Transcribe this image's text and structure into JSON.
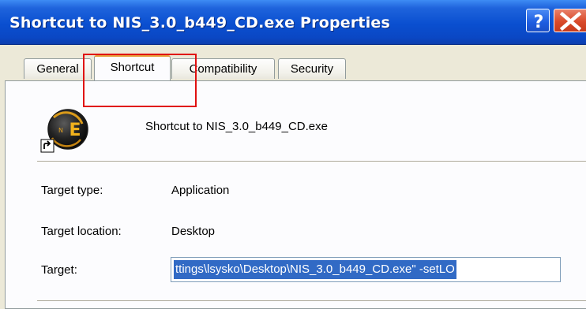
{
  "window": {
    "title": "Shortcut to NIS_3.0_b449_CD.exe Properties",
    "help_label": "?",
    "close_label": "X"
  },
  "tabs": [
    {
      "label": "General",
      "active": false
    },
    {
      "label": "Shortcut",
      "active": true
    },
    {
      "label": "Compatibility",
      "active": false
    },
    {
      "label": "Security",
      "active": false
    }
  ],
  "shortcut": {
    "name": "Shortcut to NIS_3.0_b449_CD.exe",
    "fields": {
      "target_type_label": "Target type:",
      "target_type_value": "Application",
      "target_location_label": "Target location:",
      "target_location_value": "Desktop",
      "target_label": "Target:",
      "target_value": "ttings\\lsysko\\Desktop\\NIS_3.0_b449_CD.exe\" -setLO"
    }
  },
  "colors": {
    "titlebar": "#0a4fd0",
    "active_tab_accent": "#e69e38",
    "selection": "#316ac5",
    "annotation_box": "#e01010"
  }
}
